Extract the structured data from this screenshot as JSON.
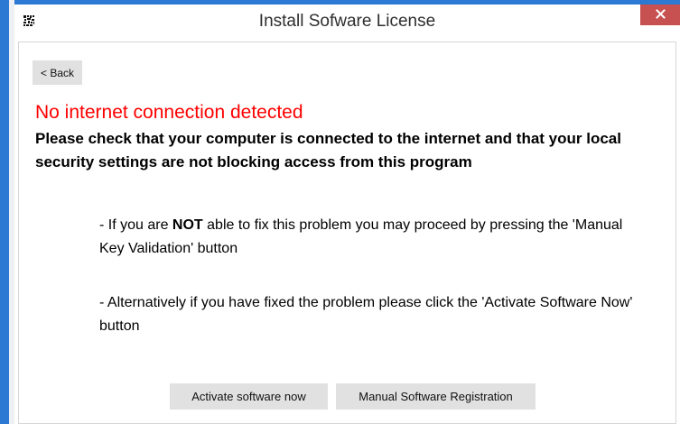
{
  "window": {
    "title": "Install Sofware License",
    "accent_color": "#2b79d3",
    "close_color": "#c75050",
    "close_glyph": "✕"
  },
  "nav": {
    "back_label": "< Back"
  },
  "message": {
    "error_title": "No internet connection detected",
    "error_color": "#ff0000",
    "error_detail": "Please check that your computer is connected to the internet and that your local security settings are not blocking access from this program",
    "hint1_prefix": "- If you are ",
    "hint1_emphasis": "NOT",
    "hint1_suffix": " able to fix this problem you may proceed by pressing the 'Manual Key Validation' button",
    "hint2": "- Alternatively if you have fixed the problem please click the 'Activate Software Now' button"
  },
  "actions": {
    "activate_label": "Activate software now",
    "manual_label": "Manual Software Registration"
  }
}
